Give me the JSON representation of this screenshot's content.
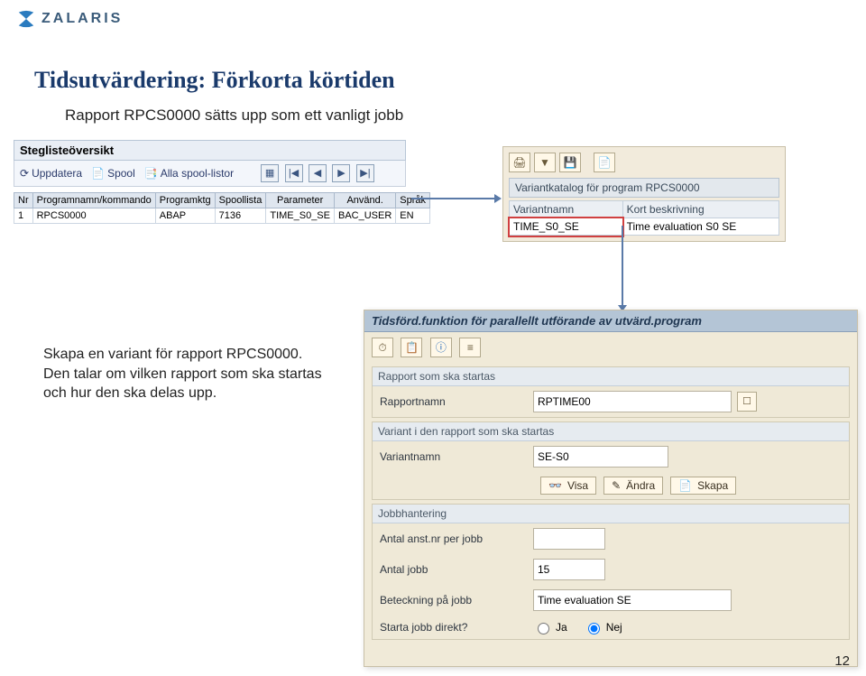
{
  "header": {
    "brand": "ZALARIS"
  },
  "title": "Tidsutvärdering: Förkorta körtiden",
  "subtitle": "Rapport RPCS0000 sätts upp som ett vanligt jobb",
  "stegliste": {
    "caption": "Steglisteöversikt",
    "btn_uppdatera": "Uppdatera",
    "btn_spool": "Spool",
    "btn_alla": "Alla spool-listor",
    "cols": [
      "Nr",
      "Programnamn/kommando",
      "Programktg",
      "Spoollista",
      "Parameter",
      "Använd.",
      "Språk"
    ],
    "row": [
      "1",
      "RPCS0000",
      "ABAP",
      "7136",
      "TIME_S0_SE",
      "BAC_USER",
      "EN"
    ]
  },
  "variant": {
    "header": "Variantkatalog för program RPCS0000",
    "col_name": "Variantnamn",
    "col_desc": "Kort beskrivning",
    "name": "TIME_S0_SE",
    "desc": "Time evaluation S0 SE"
  },
  "desc": {
    "l1": "Skapa en variant för rapport RPCS0000.",
    "l2": "Den talar om vilken rapport som ska startas och hur den ska delas upp."
  },
  "panel": {
    "title": "Tidsförd.funktion för parallellt utförande av utvärd.program",
    "grp1": "Rapport som ska startas",
    "rapportnamn_label": "Rapportnamn",
    "rapportnamn_value": "RPTIME00",
    "grp2": "Variant i den rapport som ska startas",
    "variantnamn_label": "Variantnamn",
    "variantnamn_value": "SE-S0",
    "btn_visa": "Visa",
    "btn_andra": "Ändra",
    "btn_skapa": "Skapa",
    "grp3": "Jobbhantering",
    "antal_anst_label": "Antal anst.nr per jobb",
    "antal_anst_value": "",
    "antal_jobb_label": "Antal jobb",
    "antal_jobb_value": "15",
    "beteckning_label": "Beteckning på jobb",
    "beteckning_value": "Time evaluation SE",
    "starta_label": "Starta jobb direkt?",
    "radio_ja": "Ja",
    "radio_nej": "Nej"
  },
  "page_number": "12"
}
